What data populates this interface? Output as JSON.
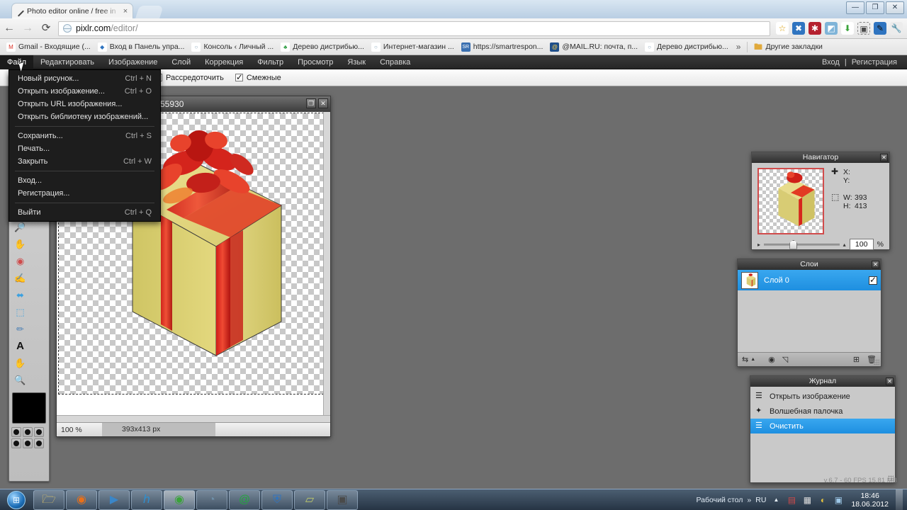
{
  "browser": {
    "tab": {
      "title": "Photo editor online / free in",
      "close": "×",
      "favicon_name": "pixlr-pencil-icon"
    },
    "window_controls": {
      "minimize": "—",
      "maximize": "❐",
      "close": "✕"
    },
    "nav": {
      "back": "←",
      "forward": "→",
      "reload": "⟳"
    },
    "omnibox": {
      "domain": "pixlr.com",
      "path": "/editor/",
      "star": "☆"
    },
    "extensions": [
      {
        "name": "bookmark-star-icon",
        "glyph": "☆",
        "color": "#f7c948",
        "bg": "#ffffff",
        "fg": "#d79b00"
      },
      {
        "name": "blue-x-extension-icon",
        "glyph": "✖",
        "bg": "#2f74c0",
        "fg": "#ffffff"
      },
      {
        "name": "red-asterisk-extension-icon",
        "glyph": "✱",
        "bg": "#b5212f",
        "fg": "#ffffff"
      },
      {
        "name": "blue-page-extension-icon",
        "glyph": "◩",
        "bg": "#7fb4d8",
        "fg": "#ffffff"
      },
      {
        "name": "green-download-arrow-icon",
        "glyph": "⬇",
        "bg": "#ffffff",
        "fg": "#3aa33a"
      },
      {
        "name": "evernote-extension-icon",
        "glyph": "▣",
        "bg": "#e9e9e9",
        "fg": "#4a4a4a"
      },
      {
        "name": "black-pen-extension-icon",
        "glyph": "✒",
        "bg": "#2f74c0",
        "fg": "#101010"
      },
      {
        "name": "wrench-settings-icon",
        "glyph": "🔧",
        "bg": "#e9e9e9",
        "fg": "#555555"
      }
    ],
    "bookmarks": [
      {
        "label": "Gmail - Входящие (...",
        "icon_name": "gmail-icon",
        "glyph": "M",
        "bg": "#ffffff",
        "fg": "#d93025"
      },
      {
        "label": "Вход в Панель упра...",
        "icon_name": "blue-diamond-icon",
        "glyph": "◆",
        "bg": "#ffffff",
        "fg": "#2f74c0"
      },
      {
        "label": "Консоль ‹ Личный ...",
        "icon_name": "globe-icon",
        "glyph": "○",
        "bg": "#ffffff",
        "fg": "#8aa6bb"
      },
      {
        "label": "Дерево дистрибью...",
        "icon_name": "green-tree-icon",
        "glyph": "♣",
        "bg": "#ffffff",
        "fg": "#2f9e44"
      },
      {
        "label": "Интернет-магазин ...",
        "icon_name": "globe-icon",
        "glyph": "○",
        "bg": "#ffffff",
        "fg": "#8aa6bb"
      },
      {
        "label": "https://smartrespon...",
        "icon_name": "smartresponder-icon",
        "glyph": "SR",
        "bg": "#3a6fb0",
        "fg": "#ffffff"
      },
      {
        "label": "@MAIL.RU: почта, п...",
        "icon_name": "mailru-icon",
        "glyph": "@",
        "bg": "#1f4f8a",
        "fg": "#ffd24d"
      },
      {
        "label": "Дерево дистрибью...",
        "icon_name": "globe-icon",
        "glyph": "○",
        "bg": "#ffffff",
        "fg": "#8aa6bb"
      }
    ],
    "bookmarks_overflow": "»",
    "other_bookmarks": {
      "label": "Другие закладки",
      "icon_name": "folder-icon",
      "glyph": "🗀"
    }
  },
  "pixlr": {
    "menu": [
      {
        "label": "Файл",
        "active": true
      },
      {
        "label": "Редактировать"
      },
      {
        "label": "Изображение"
      },
      {
        "label": "Слой"
      },
      {
        "label": "Коррекция"
      },
      {
        "label": "Фильтр"
      },
      {
        "label": "Просмотр"
      },
      {
        "label": "Язык"
      },
      {
        "label": "Справка"
      }
    ],
    "account": {
      "login": "Вход",
      "separator": "|",
      "register": "Регистрация"
    },
    "file_menu": {
      "groups": [
        [
          {
            "label": "Новый рисунок...",
            "shortcut": "Ctrl + N"
          },
          {
            "label": "Открыть изображение...",
            "shortcut": "Ctrl + O"
          },
          {
            "label": "Открыть URL изображения...",
            "shortcut": ""
          },
          {
            "label": "Открыть библиотеку изображений...",
            "shortcut": ""
          }
        ],
        [
          {
            "label": "Сохранить...",
            "shortcut": "Ctrl + S"
          },
          {
            "label": "Печать...",
            "shortcut": ""
          },
          {
            "label": "Закрыть",
            "shortcut": "Ctrl + W"
          }
        ],
        [
          {
            "label": "Вход...",
            "shortcut": ""
          },
          {
            "label": "Регистрация...",
            "shortcut": ""
          }
        ],
        [
          {
            "label": "Выйти",
            "shortcut": "Ctrl + Q"
          }
        ]
      ]
    },
    "options_bar": [
      {
        "label": "Рассредоточить",
        "checked": true
      },
      {
        "label": "Смежные",
        "checked": true
      }
    ],
    "tools": [
      {
        "name": "crop-tool",
        "glyph": "⌗",
        "color": "#3b6fa8"
      },
      {
        "name": "stamp-tool",
        "glyph": "⚑",
        "color": "#c8881f"
      },
      {
        "name": "magic-wand-tool",
        "glyph": "✦",
        "color": "#5b8ec4"
      },
      {
        "name": "heal-tool",
        "glyph": "◑",
        "color": "#d6b35c"
      },
      {
        "name": "blur-tool",
        "glyph": "💧",
        "color": "#2f8fd0"
      },
      {
        "name": "sharpen-tool",
        "glyph": "▲",
        "color": "#2f6fd0"
      },
      {
        "name": "smudge-tool",
        "glyph": "☝",
        "color": "#e0a85c"
      },
      {
        "name": "sponge-tool",
        "glyph": "⬤",
        "color": "#e3c23e"
      },
      {
        "name": "dodge-tool",
        "glyph": "🔎",
        "color": "#333333"
      },
      {
        "name": "burn-tool",
        "glyph": "✋",
        "color": "#d9a168"
      },
      {
        "name": "red-eye-tool",
        "glyph": "◉",
        "color": "#cf4a4a"
      },
      {
        "name": "bloat-tool",
        "glyph": "✍",
        "color": "#d9a168"
      },
      {
        "name": "pinch-tool",
        "glyph": "⬌",
        "color": "#3aa0e0"
      },
      {
        "name": "warp-tool",
        "glyph": "⬚",
        "color": "#3aa0e0"
      },
      {
        "name": "color-picker-tool",
        "glyph": "✐",
        "color": "#4a7fb5"
      },
      {
        "name": "type-tool",
        "glyph": "A",
        "color": "#1a1a1a"
      },
      {
        "name": "hand-tool",
        "glyph": "✋",
        "color": "#e0a85c"
      },
      {
        "name": "zoom-tool",
        "glyph": "🔍",
        "color": "#3a3a3a"
      }
    ],
    "color_swatch": {
      "name": "foreground-color",
      "value": "#000000"
    },
    "image_window": {
      "title": "55930",
      "restore": "❐",
      "close": "✕",
      "status_zoom": "100 %",
      "status_size": "393x413 px"
    },
    "navigator": {
      "title": "Навигатор",
      "close": "✕",
      "cursor_icon": "✚",
      "x_label": "X:",
      "x_value": "",
      "y_label": "Y:",
      "y_value": "",
      "size_icon": "⬚",
      "w_label": "W:",
      "w_value": "393",
      "h_label": "H:",
      "h_value": "413",
      "zoom_value": "100",
      "zoom_unit": "%"
    },
    "layers": {
      "title": "Слои",
      "close": "✕",
      "items": [
        {
          "name": "Слой 0",
          "visible": true,
          "selected": true
        }
      ],
      "toolbar": [
        {
          "name": "blend-mode-button",
          "glyph": "⇆"
        },
        {
          "name": "blend-mode-arrow",
          "glyph": "▲"
        },
        {
          "name": "layer-style-button",
          "glyph": "◉"
        },
        {
          "name": "layer-mask-button",
          "glyph": "◱"
        },
        {
          "name": "add-layer-button",
          "glyph": "⊞"
        },
        {
          "name": "delete-layer-button",
          "glyph": "🗑"
        }
      ]
    },
    "history": {
      "title": "Журнал",
      "close": "✕",
      "items": [
        {
          "label": "Открыть изображение",
          "icon_name": "document-icon",
          "glyph": "☰",
          "selected": false
        },
        {
          "label": "Волшебная палочка",
          "icon_name": "magic-wand-icon",
          "glyph": "✦",
          "selected": false
        },
        {
          "label": "Очистить",
          "icon_name": "document-icon",
          "glyph": "☰",
          "selected": true
        }
      ]
    },
    "version": "v.6.7 - 60 FPS 15.81 MB"
  },
  "taskbar": {
    "start_glyph": "⊞",
    "items": [
      {
        "name": "explorer-taskbar-button",
        "glyph": "🗁",
        "color": "#e8c96a",
        "active": false
      },
      {
        "name": "firefox-taskbar-button",
        "glyph": "◉",
        "color": "#e8701a",
        "active": false
      },
      {
        "name": "media-player-taskbar-button",
        "glyph": "▶",
        "color": "#3a86c8",
        "active": false
      },
      {
        "name": "internet-explorer-taskbar-button",
        "glyph": "℮",
        "color": "#2f8fd0",
        "active": false
      },
      {
        "name": "chrome-taskbar-button",
        "glyph": "◉",
        "color": "#3aa33a",
        "active": true
      },
      {
        "name": "safari-taskbar-button",
        "glyph": "◔",
        "color": "#6e8fa8",
        "active": false
      },
      {
        "name": "mailru-agent-taskbar-button",
        "glyph": "@",
        "color": "#23a63f",
        "active": false
      },
      {
        "name": "security-shield-taskbar-button",
        "glyph": "⛨",
        "color": "#2f74c0",
        "active": false
      },
      {
        "name": "notes-taskbar-button",
        "glyph": "▱",
        "color": "#cfd87a",
        "active": false
      },
      {
        "name": "camcorder-taskbar-button",
        "glyph": "▣",
        "color": "#4a4a4a",
        "active": false
      }
    ],
    "tray": {
      "show_desktop": "Рабочий стол",
      "overflow": "»",
      "language": "RU",
      "expand": "▲",
      "icons": [
        {
          "name": "antivirus-tray-icon",
          "glyph": "▤",
          "color": "#cf4a4a"
        },
        {
          "name": "network-tray-icon",
          "glyph": "▦",
          "color": "#dedede"
        },
        {
          "name": "updates-tray-icon",
          "glyph": "◐",
          "color": "#e3c23e"
        },
        {
          "name": "monitor-tray-icon",
          "glyph": "▣",
          "color": "#6fa8d8"
        }
      ],
      "time": "18:46",
      "date": "18.06.2012"
    }
  }
}
